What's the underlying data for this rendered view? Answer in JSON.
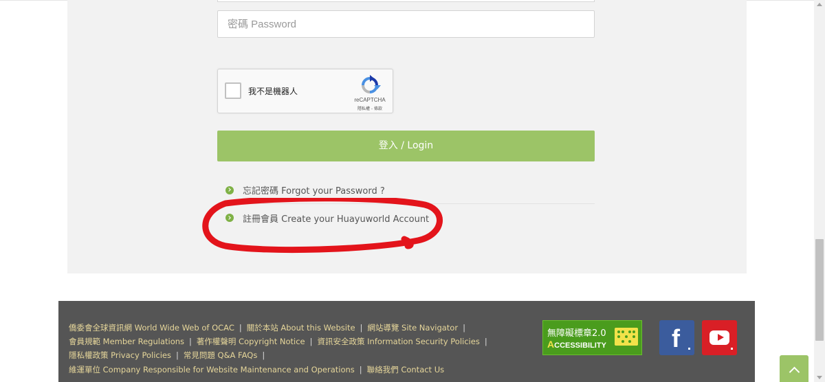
{
  "login_form": {
    "password_placeholder": "密碼 Password",
    "recaptcha": {
      "label": "我不是機器人",
      "brand": "reCAPTCHA",
      "links": "隱私權 - 條款"
    },
    "login_button_label": "登入 / Login",
    "forgot_password_link": "忘記密碼 Forgot your Password ?",
    "register_link": "註冊會員 Create your Huayuworld Account"
  },
  "footer": {
    "links": [
      "僑委會全球資訊網 World Wide Web of OCAC",
      "關於本站 About this Website",
      "網站導覽 Site Navigator",
      "會員規範 Member Regulations",
      "著作權聲明 Copyright Notice",
      "資訊安全政策 Information Security Policies",
      "隱私權政策 Privacy Policies",
      "常見問題 Q&A FAQs",
      "維運單位 Company Responsible for Website Maintenance and Operations",
      "聯絡我們 Contact Us"
    ],
    "separator": "|",
    "accessibility_badge": {
      "title": "無障礙標章2.0",
      "subtitle_a": "A",
      "subtitle_rest": "CCESSIBILITY"
    },
    "facebook_letter": "f"
  },
  "colors": {
    "accent_green": "#9cc467",
    "footer_background": "#555555",
    "footer_link": "#e6d69a",
    "annotation_red": "#e3141b",
    "facebook_blue": "#3b5c9d",
    "youtube_red": "#d91f26"
  },
  "icons": {
    "bullet": "chevron-circle-right-icon",
    "back_to_top": "chevron-up-icon",
    "facebook": "facebook-icon",
    "youtube": "youtube-icon",
    "recaptcha": "recaptcha-logo-icon"
  }
}
